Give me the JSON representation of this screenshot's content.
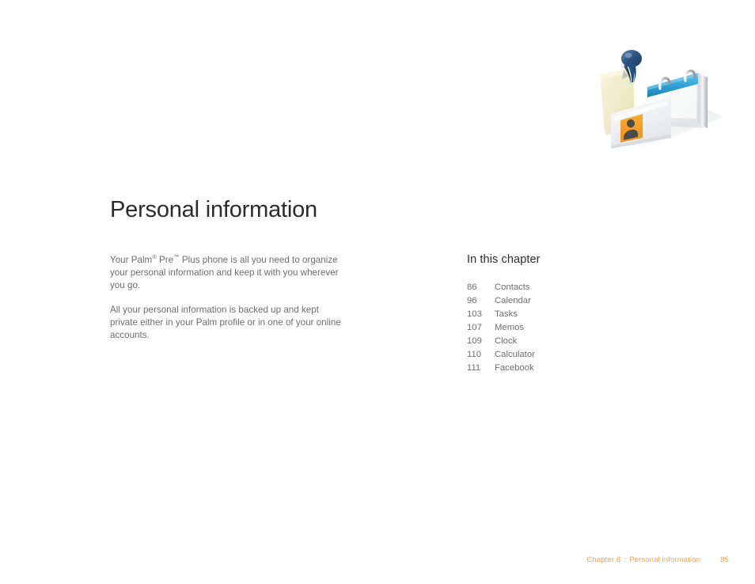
{
  "document": {
    "title": "Personal information"
  },
  "illustration": {
    "name": "personal-information-illustration",
    "elements": [
      {
        "name": "sticky-note",
        "color": "#f2efcd"
      },
      {
        "name": "pushpin",
        "color": "#2a4f7c"
      },
      {
        "name": "flip-calendar",
        "color": "#3fa9dd"
      },
      {
        "name": "contact-card",
        "color": "#f7f7f7"
      },
      {
        "name": "contact-avatar",
        "color": "#f5a623"
      }
    ]
  },
  "intro": {
    "paragraph1_part1": "Your Palm",
    "paragraph1_reg": "®",
    "paragraph1_part2": " Pre",
    "paragraph1_tm": "™",
    "paragraph1_part3": " Plus phone is all you need to organize your personal information and keep it with you wherever you go.",
    "paragraph2": "All your personal information is backed up and kept private either in your Palm profile or in one of your online accounts."
  },
  "chapter": {
    "heading": "In this chapter",
    "entries": [
      {
        "page": "86",
        "label": "Contacts"
      },
      {
        "page": "96",
        "label": "Calendar"
      },
      {
        "page": "103",
        "label": "Tasks"
      },
      {
        "page": "107",
        "label": "Memos"
      },
      {
        "page": "109",
        "label": "Clock"
      },
      {
        "page": "110",
        "label": "Calculator"
      },
      {
        "page": "111",
        "label": "Facebook"
      }
    ]
  },
  "footer": {
    "chapter_label": "Chapter 6",
    "separator": ":",
    "chapter_title": "Personal information",
    "page_number": "85",
    "color": "#f6a450"
  }
}
